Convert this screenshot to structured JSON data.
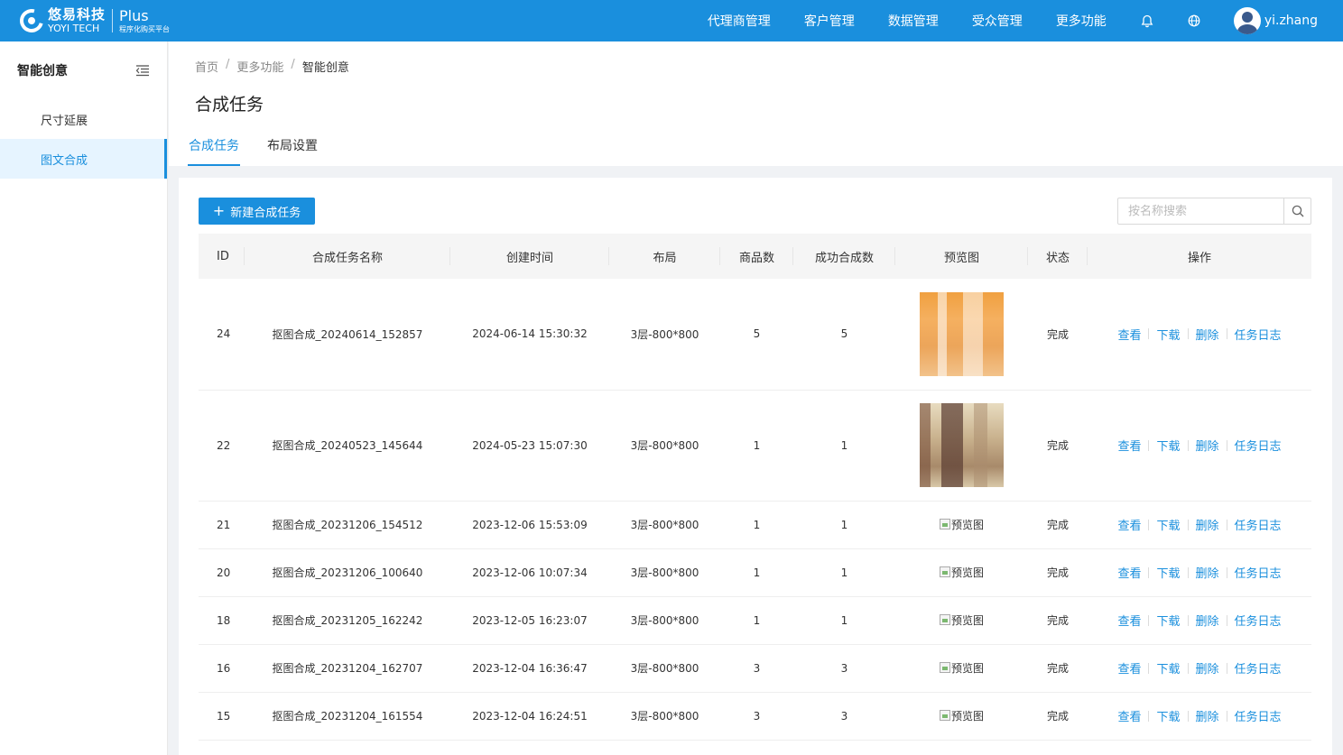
{
  "brand": {
    "name_cn": "悠易科技",
    "name_en": "YOYI TECH",
    "product": "Plus",
    "product_sub": "程序化购买平台"
  },
  "topnav": {
    "items": [
      "代理商管理",
      "客户管理",
      "数据管理",
      "受众管理",
      "更多功能"
    ],
    "user": "yi.zhang"
  },
  "sidebar": {
    "title": "智能创意",
    "items": [
      {
        "label": "尺寸延展",
        "active": false
      },
      {
        "label": "图文合成",
        "active": true
      }
    ]
  },
  "breadcrumb": {
    "home": "首页",
    "parent": "更多功能",
    "current": "智能创意",
    "separator": "/"
  },
  "page_title": "合成任务",
  "tabs": [
    {
      "label": "合成任务",
      "active": true
    },
    {
      "label": "布局设置",
      "active": false
    }
  ],
  "toolbar": {
    "new_button": "新建合成任务",
    "plus": "+",
    "search_placeholder": "按名称搜索"
  },
  "table": {
    "columns": [
      "ID",
      "合成任务名称",
      "创建时间",
      "布局",
      "商品数",
      "成功合成数",
      "预览图",
      "状态",
      "操作"
    ],
    "actions": [
      "查看",
      "下载",
      "删除",
      "任务日志"
    ],
    "broken_image_alt": "预览图",
    "rows": [
      {
        "id": "24",
        "name": "抠图合成_20240614_152857",
        "created": "2024-06-14 15:30:32",
        "layout": "3层-800*800",
        "products": "5",
        "success": "5",
        "preview": "image-orange",
        "status": "完成"
      },
      {
        "id": "22",
        "name": "抠图合成_20240523_145644",
        "created": "2024-05-23 15:07:30",
        "layout": "3层-800*800",
        "products": "1",
        "success": "1",
        "preview": "image-beige",
        "status": "完成"
      },
      {
        "id": "21",
        "name": "抠图合成_20231206_154512",
        "created": "2023-12-06 15:53:09",
        "layout": "3层-800*800",
        "products": "1",
        "success": "1",
        "preview": "broken",
        "status": "完成"
      },
      {
        "id": "20",
        "name": "抠图合成_20231206_100640",
        "created": "2023-12-06 10:07:34",
        "layout": "3层-800*800",
        "products": "1",
        "success": "1",
        "preview": "broken",
        "status": "完成"
      },
      {
        "id": "18",
        "name": "抠图合成_20231205_162242",
        "created": "2023-12-05 16:23:07",
        "layout": "3层-800*800",
        "products": "1",
        "success": "1",
        "preview": "broken",
        "status": "完成"
      },
      {
        "id": "16",
        "name": "抠图合成_20231204_162707",
        "created": "2023-12-04 16:36:47",
        "layout": "3层-800*800",
        "products": "3",
        "success": "3",
        "preview": "broken",
        "status": "完成"
      },
      {
        "id": "15",
        "name": "抠图合成_20231204_161554",
        "created": "2023-12-04 16:24:51",
        "layout": "3层-800*800",
        "products": "3",
        "success": "3",
        "preview": "broken",
        "status": "完成"
      }
    ]
  },
  "colors": {
    "primary": "#1a8fdd",
    "header_bg": "#1a8fdd",
    "active_menu_bg": "#e6f4ff"
  }
}
